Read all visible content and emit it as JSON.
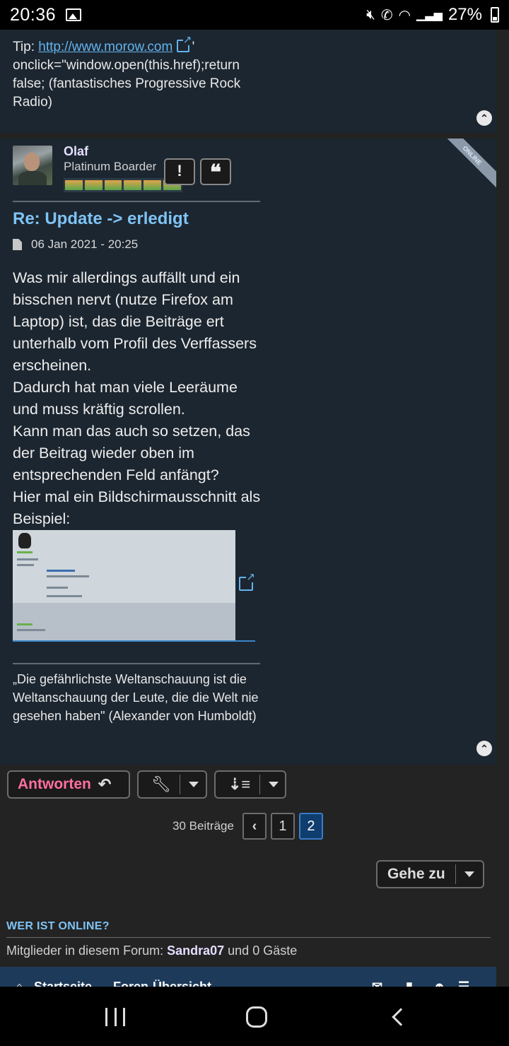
{
  "status_bar": {
    "time": "20:36",
    "battery": "27%"
  },
  "prev_post": {
    "tip_label": "Tip:",
    "link_text": "http://www.morow.com",
    "text_after_link": "\"",
    "text_rest": "onclick=\"window.open(this.href);return false; (fantastisches Progressive Rock Radio)"
  },
  "post": {
    "author": "Olaf",
    "rank": "Platinum Boarder",
    "online_badge": "ONLINE",
    "report_button": "!",
    "quote_button": "❝",
    "title": "Re: Update -> erledigt",
    "date": "06 Jan 2021 - 20:25",
    "body": [
      "Was mir allerdings auffällt und ein bisschen nervt (nutze Firefox am Laptop) ist, das die Beiträge ert unterhalb vom Profil des Verffassers erscheinen.",
      "Dadurch hat man viele Leeräume und muss kräftig scrollen.",
      "Kann man das auch so setzen, das der Beitrag wieder oben im entsprechenden Feld anfängt?",
      "Hier mal ein Bildschirmausschnitt als Beispiel:"
    ],
    "signature": "„Die gefährlichste Weltanschauung ist die Weltanschauung der Leute, die die Welt nie gesehen haben\" (Alexander von Humboldt)"
  },
  "actions": {
    "reply_label": "Antworten",
    "post_count": "30 Beiträge",
    "pages": [
      "1",
      "2"
    ],
    "current_page": "2",
    "goto_label": "Gehe zu"
  },
  "who_online": {
    "heading": "WER IST ONLINE?",
    "prefix": "Mitglieder in diesem Forum:",
    "member": "Sandra07",
    "suffix": "und 0 Gäste"
  },
  "footer_nav": {
    "home": "Startseite",
    "forum": "Foren-Übersicht"
  },
  "colors": {
    "accent_blue": "#7fc3f4",
    "reply_pink": "#ff6f9d",
    "post_bg": "#1c2630"
  }
}
